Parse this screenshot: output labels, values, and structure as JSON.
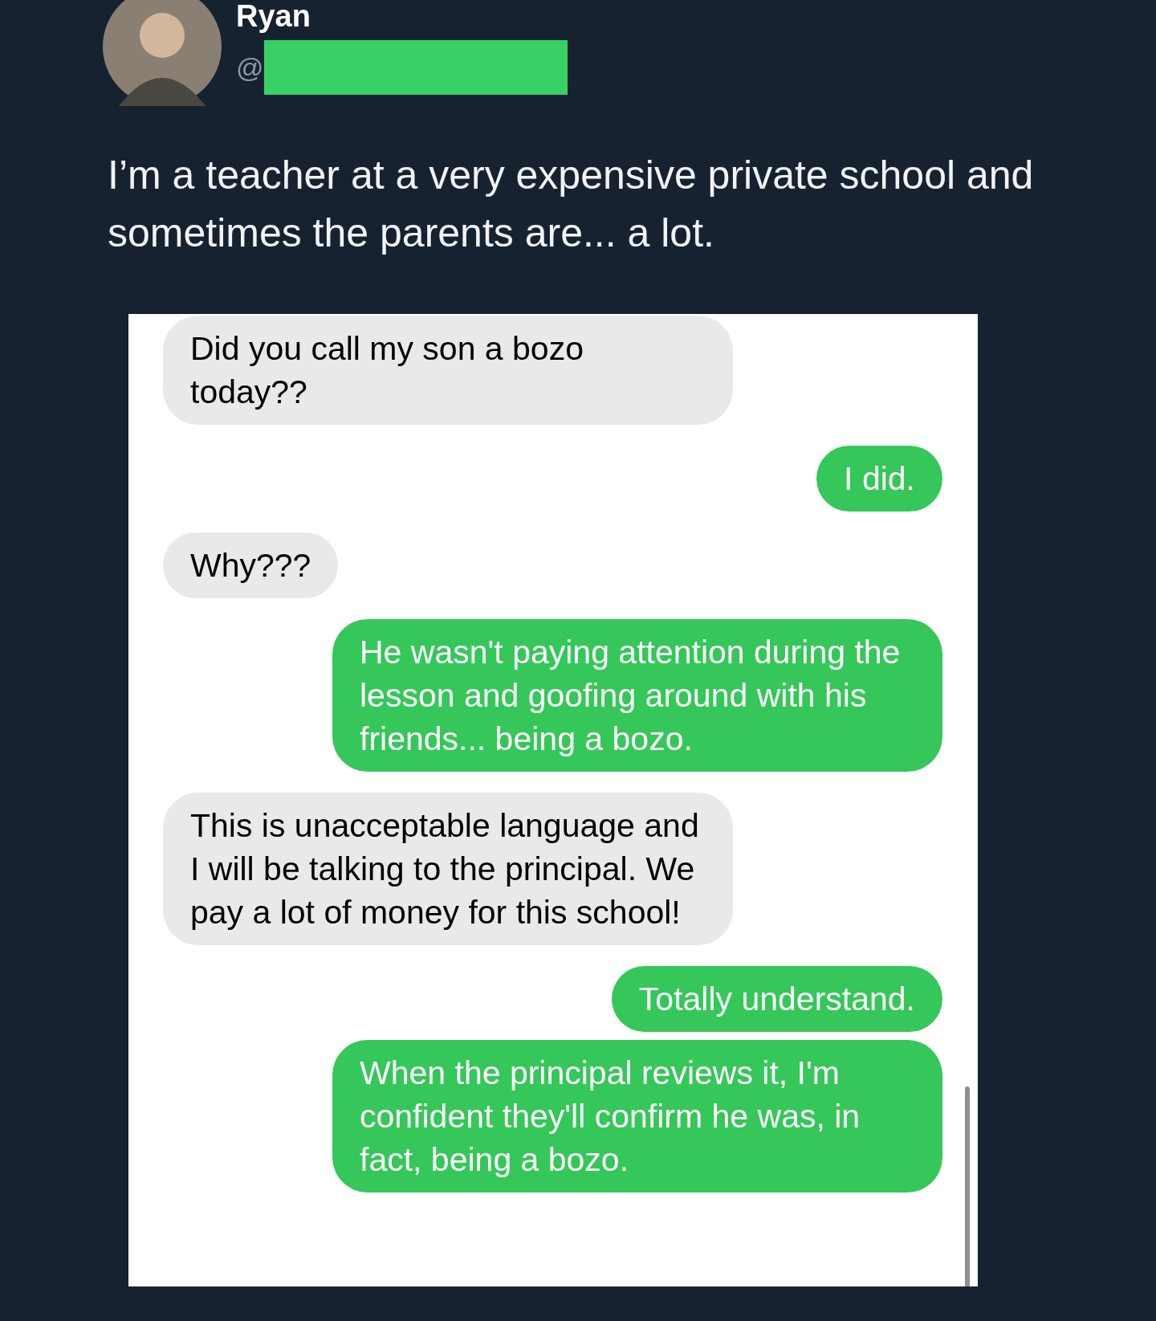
{
  "author": {
    "name": "Ryan",
    "handle": "@"
  },
  "tweet_text": "I’m a teacher at a very expensive private school and sometimes the parents are... a lot.",
  "messages": [
    {
      "kind": "received",
      "text": "Did you call my son a bozo today??"
    },
    {
      "kind": "sent",
      "text": "I did."
    },
    {
      "kind": "received",
      "text": "Why???"
    },
    {
      "kind": "sent",
      "text": "He wasn't paying attention during the lesson and goofing around with his friends... being a bozo."
    },
    {
      "kind": "received",
      "text": "This is unacceptable language and I will be talking to the principal. We pay a lot of money for this school!"
    },
    {
      "kind": "sent",
      "text": "Totally understand."
    },
    {
      "kind": "sent",
      "text": "When the principal reviews it, I'm confident they'll confirm he was, in fact, being a bozo."
    }
  ]
}
